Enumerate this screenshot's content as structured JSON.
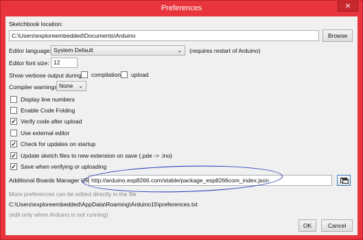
{
  "window": {
    "title": "Preferences",
    "close_glyph": "✕"
  },
  "sketchbook": {
    "label": "Sketchbook location:",
    "path": "C:\\Users\\exploreembedded\\Documents\\Arduino",
    "browse_label": "Browse"
  },
  "editor_language": {
    "label": "Editor language:",
    "value": "System Default",
    "note": "(requires restart of Arduino)"
  },
  "editor_font_size": {
    "label": "Editor font size:",
    "value": "12"
  },
  "verbose": {
    "label": "Show verbose output during:",
    "compilation": {
      "label": "compilation",
      "checked": false
    },
    "upload": {
      "label": "upload",
      "checked": false
    }
  },
  "compiler_warnings": {
    "label": "Compiler warnings:",
    "value": "None"
  },
  "options": [
    {
      "label": "Display line numbers",
      "checked": false
    },
    {
      "label": "Enable Code Folding",
      "checked": false
    },
    {
      "label": "Verify code after upload",
      "checked": true
    },
    {
      "label": "Use external editor",
      "checked": false
    },
    {
      "label": "Check for updates on startup",
      "checked": true
    },
    {
      "label": "Update sketch files to new extension on save (.pde -> .ino)",
      "checked": true
    },
    {
      "label": "Save when verifying or uploading",
      "checked": true
    }
  ],
  "boards_manager": {
    "label": "Additional Boards Manager URLs:",
    "value": "http://arduino.esp8266.com/stable/package_esp8266com_index.json",
    "edit_icon": "window-list-icon"
  },
  "more_prefs_note": "More preferences can be edited directly in the file",
  "prefs_path": "C:\\Users\\exploreembedded\\AppData\\Roaming\\Arduino15\\preferences.txt",
  "edit_note": "(edit only when Arduino is not running)",
  "buttons": {
    "ok": "OK",
    "cancel": "Cancel"
  },
  "colors": {
    "title_bar": "#e8343c",
    "annotation_oval": "#1c2fb8",
    "checkmark": "#111111"
  }
}
